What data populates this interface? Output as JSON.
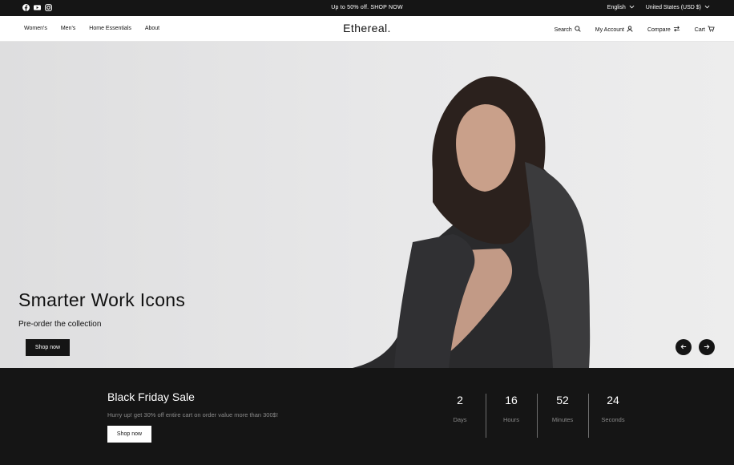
{
  "topbar": {
    "promo": "Up to 50% off. SHOP NOW",
    "language": "English",
    "currency": "United States (USD $)",
    "icons": [
      "facebook-icon",
      "youtube-icon",
      "instagram-icon"
    ]
  },
  "nav": {
    "logo": "Ethereal.",
    "left": [
      "Women's",
      "Men's",
      "Home Essentials",
      "About"
    ],
    "search": "Search",
    "account": "My Account",
    "compare": "Compare",
    "cart": "Cart"
  },
  "hero": {
    "title": "Smarter Work Icons",
    "subtitle": "Pre-order the collection",
    "cta": "Shop now"
  },
  "sale": {
    "title": "Black Friday Sale",
    "description": "Hurry up! get 30% off entire cart on order value more than 300$!",
    "cta": "Shop now",
    "countdown": [
      {
        "value": "2",
        "label": "Days"
      },
      {
        "value": "16",
        "label": "Hours"
      },
      {
        "value": "52",
        "label": "Minutes"
      },
      {
        "value": "24",
        "label": "Seconds"
      }
    ]
  },
  "colors": {
    "dark": "#151515",
    "muted": "#8a8a8a",
    "hero_bg": "#e5e5e6"
  }
}
